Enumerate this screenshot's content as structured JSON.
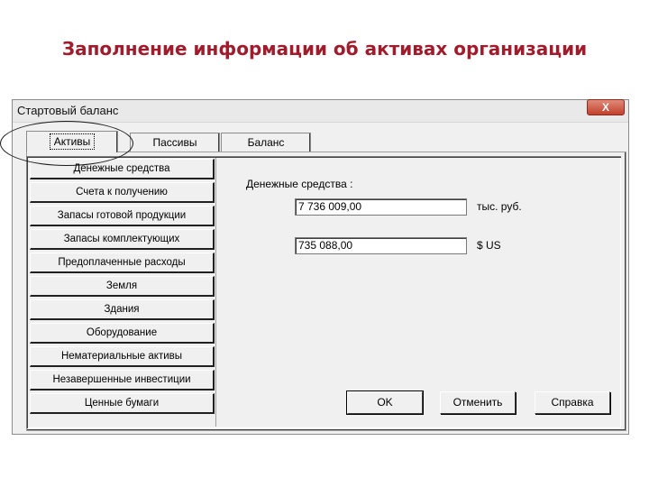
{
  "slide": {
    "title": "Заполнение информации об активах организации"
  },
  "window": {
    "title": "Стартовый баланс",
    "close_glyph": "X"
  },
  "tabs": [
    {
      "label": "Активы",
      "active": true
    },
    {
      "label": "Пассивы",
      "active": false
    },
    {
      "label": "Баланс",
      "active": false
    }
  ],
  "categories": [
    "Денежные средства",
    "Счета к получению",
    "Запасы готовой продукции",
    "Запасы комплектующих",
    "Предоплаченные расходы",
    "Земля",
    "Здания",
    "Оборудование",
    "Нематериальные активы",
    "Незавершенные инвестиции",
    "Ценные бумаги"
  ],
  "form": {
    "caption": "Денежные средства :",
    "rub_value": "7 736 009,00",
    "rub_unit": "тыс. руб.",
    "usd_value": "735 088,00",
    "usd_unit": "$ US"
  },
  "buttons": {
    "ok": "OK",
    "cancel": "Отменить",
    "help": "Справка"
  },
  "colors": {
    "title": "#a01c2c",
    "close": "#c1412d",
    "window_bg": "#f0f0f0"
  }
}
